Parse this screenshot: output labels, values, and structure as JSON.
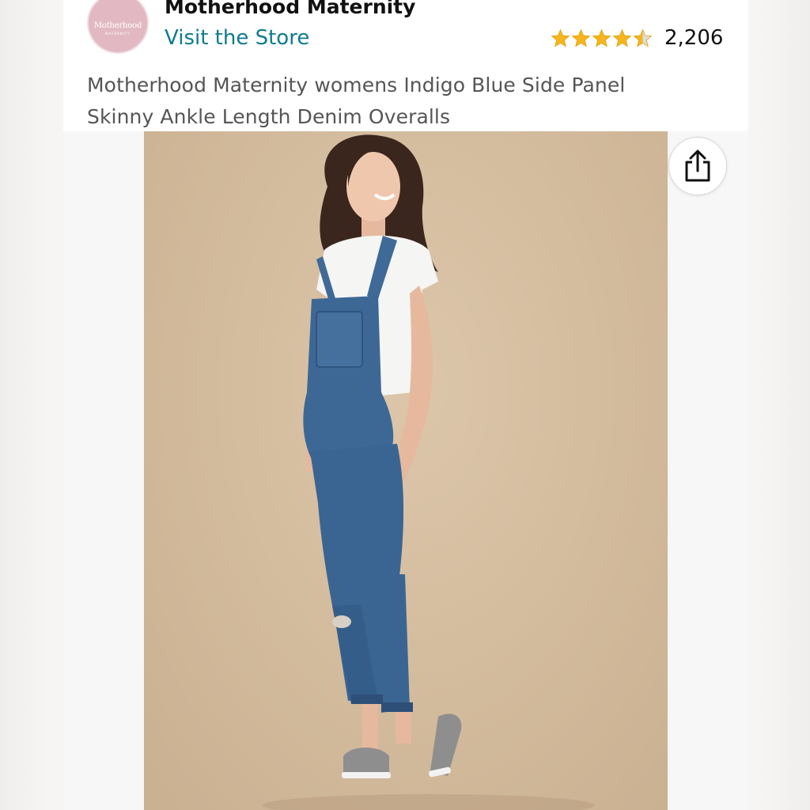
{
  "brand": {
    "logo_text": "Motherhood",
    "logo_subtext": "MATERNITY",
    "name": "Motherhood Maternity",
    "store_link": "Visit the Store"
  },
  "rating": {
    "stars": 4.5,
    "max_stars": 5,
    "review_count": "2,206",
    "star_color": "#f5b51e",
    "star_empty_color": "#dddddd"
  },
  "product": {
    "title": "Motherhood Maternity womens Indigo Blue Side Panel Skinny Ankle Length Denim Overalls"
  },
  "gallery": {
    "share_icon": "share-icon"
  },
  "colors": {
    "link": "#0f7c8c",
    "title_text": "#555555",
    "logo_bg": "#e2b9c2"
  }
}
